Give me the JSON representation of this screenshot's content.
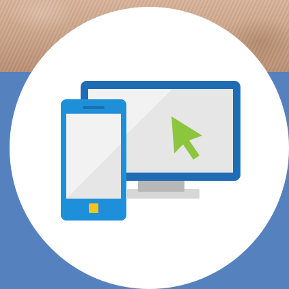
{
  "graphic": {
    "icons": [
      "desktop-monitor-icon",
      "smartphone-icon",
      "cursor-arrow-icon"
    ],
    "colors": {
      "photo_tone": "#caa286",
      "panel_blue": "#5581bf",
      "circle_white": "#ffffff",
      "monitor_frame": "#1f6cb5",
      "phone_body": "#1e90d9",
      "screen_light": "#f2f2f2",
      "cursor_green": "#8cc63f",
      "phone_button": "#f5c518",
      "stand_gray": "#c9c9c9"
    }
  }
}
